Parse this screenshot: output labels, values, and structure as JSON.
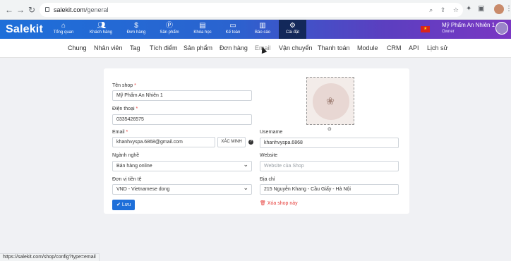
{
  "browser": {
    "url_host": "salekit.com",
    "url_path": "/general",
    "status_url": "https://salekit.com/shop/config?type=email"
  },
  "app": {
    "logo": "Salekit",
    "menu": [
      {
        "label": "Tổng quan",
        "icon": "home-icon"
      },
      {
        "label": "Khách hàng",
        "icon": "users-icon"
      },
      {
        "label": "Đơn hàng",
        "icon": "dollar-icon"
      },
      {
        "label": "Sản phẩm",
        "icon": "product-icon"
      },
      {
        "label": "Khóa học",
        "icon": "book-icon"
      },
      {
        "label": "Kế toán",
        "icon": "card-icon"
      },
      {
        "label": "Báo cáo",
        "icon": "chart-icon"
      },
      {
        "label": "Cài đặt",
        "icon": "gear-icon",
        "active": true
      }
    ],
    "user": {
      "name": "Mỹ Phẩm An Nhiên 1",
      "role": "Owner"
    }
  },
  "subtabs": [
    "Chung",
    "Nhân viên",
    "Tag",
    "Tích điểm",
    "Sản phẩm",
    "Đơn hàng",
    "Email",
    "Vận chuyển",
    "Thanh toán",
    "Module",
    "CRM",
    "API",
    "Lịch sử"
  ],
  "form": {
    "shop_name": {
      "label": "Tên shop",
      "value": "Mỹ Phẩm An Nhiên 1"
    },
    "phone": {
      "label": "Điện thoại",
      "value": "0335426575"
    },
    "email": {
      "label": "Email",
      "value": "khanhvyspa.6868@gmail.com",
      "verify_label": "XÁC MINH"
    },
    "industry": {
      "label": "Ngành nghề",
      "value": "Bán hàng online"
    },
    "currency": {
      "label": "Đơn vị tiền tệ",
      "value": "VND - Vietnamese dong"
    },
    "username": {
      "label": "Username",
      "value": "khanhvyspa.6868"
    },
    "website": {
      "label": "Website",
      "placeholder": "Website của Shop"
    },
    "address": {
      "label": "Địa chỉ",
      "value": "215 Nguyễn Khang - Cầu Giấy - Hà Nội"
    },
    "save_label": "Lưu",
    "delete_label": "Xóa shop này"
  }
}
